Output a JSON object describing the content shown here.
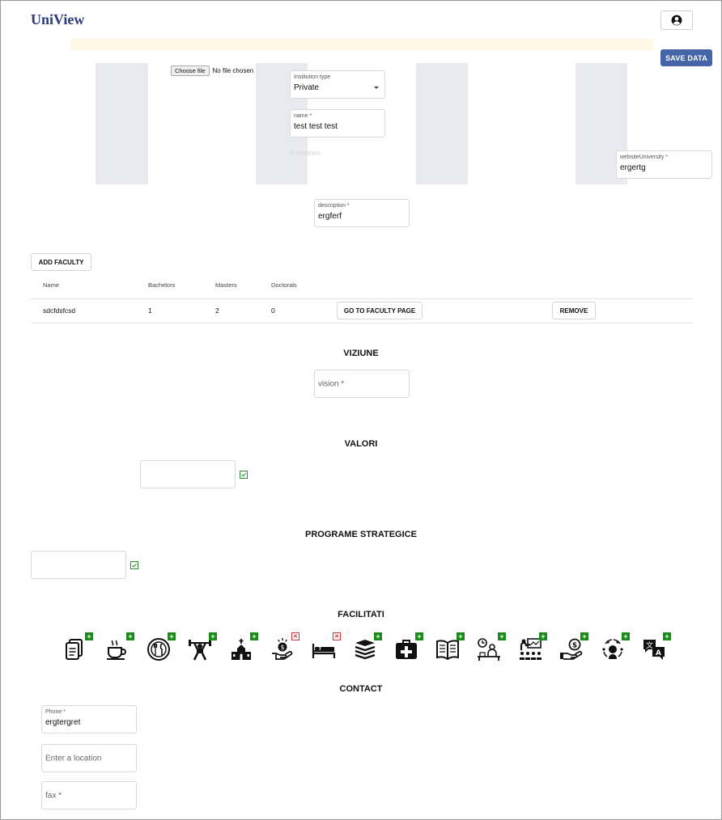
{
  "app": {
    "title": "UniView"
  },
  "toolbar": {
    "save_label": "SAVE DATA"
  },
  "upload": {
    "button": "Choose file",
    "status": "No file chosen"
  },
  "form": {
    "institution_type": {
      "label": "Institution type",
      "value": "Private"
    },
    "name": {
      "label": "name *",
      "value": "test test test"
    },
    "reviews": "0 reviews",
    "website": {
      "label": "websiteUniversity *",
      "value": "ergertg"
    },
    "description": {
      "label": "description *",
      "value": "ergferf"
    }
  },
  "faculties": {
    "add_label": "ADD FACULTY",
    "columns": [
      "Name",
      "Bachelors",
      "Masters",
      "Doctorals"
    ],
    "rows": [
      {
        "name": "sdcfdsfcsd",
        "bachelors": "1",
        "masters": "2",
        "doctorals": "0",
        "go_label": "GO TO FACULTY PAGE",
        "remove_label": "REMOVE"
      }
    ]
  },
  "vision": {
    "title": "VIZIUNE",
    "placeholder": "vision *"
  },
  "values": {
    "title": "VALORI"
  },
  "programs": {
    "title": "PROGRAME STRATEGICE"
  },
  "facilities": {
    "title": "FACILITATI",
    "items": [
      {
        "icon": "document-icon",
        "state": "add"
      },
      {
        "icon": "coffee-cup-icon",
        "state": "add"
      },
      {
        "icon": "restaurant-plate-icon",
        "state": "add"
      },
      {
        "icon": "weightlifter-icon",
        "state": "add"
      },
      {
        "icon": "church-icon",
        "state": "add"
      },
      {
        "icon": "scholarship-hand-icon",
        "state": "remove"
      },
      {
        "icon": "bed-icon",
        "state": "remove"
      },
      {
        "icon": "books-stack-icon",
        "state": "add"
      },
      {
        "icon": "first-aid-kit-icon",
        "state": "add"
      },
      {
        "icon": "open-book-icon",
        "state": "add"
      },
      {
        "icon": "study-desk-icon",
        "state": "add"
      },
      {
        "icon": "classroom-icon",
        "state": "add"
      },
      {
        "icon": "money-hand-icon",
        "state": "add"
      },
      {
        "icon": "mentoring-icon",
        "state": "add"
      },
      {
        "icon": "translation-icon",
        "state": "add"
      }
    ],
    "add_glyph": "+",
    "remove_glyph": "✕"
  },
  "contact": {
    "title": "CONTACT",
    "phone": {
      "label": "Phone *",
      "value": "ergtergret"
    },
    "location_placeholder": "Enter a location",
    "fax_placeholder": "fax *"
  },
  "colors": {
    "brand": "#2b3a7a",
    "primary_button": "#4665a8",
    "add_badge": "#1a8a1a",
    "remove_badge": "#d43030",
    "banner": "#fff8e6"
  }
}
